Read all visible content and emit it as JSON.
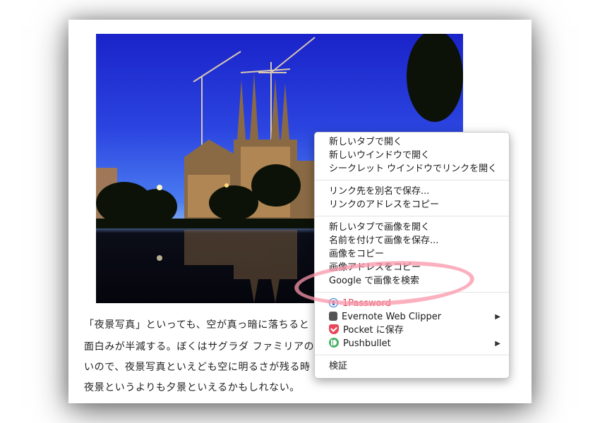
{
  "article": {
    "lines": [
      "「夜景写真」といっても、空が真っ暗に落ちると",
      "面白みが半減する。ぼくはサグラダ ファミリアの",
      "いので、夜景写真といえども空に明るさが残る時",
      "夜景というよりも夕景といえるかもしれない。"
    ]
  },
  "context_menu": {
    "group1": [
      "新しいタブで開く",
      "新しいウインドウで開く",
      "シークレット ウインドウでリンクを開く"
    ],
    "group2": [
      "リンク先を別名で保存...",
      "リンクのアドレスをコピー"
    ],
    "group3": [
      "新しいタブで画像を開く",
      "名前を付けて画像を保存...",
      "画像をコピー",
      "画像アドレスをコピー",
      "Google で画像を検索"
    ],
    "extensions": [
      {
        "label": "1Password",
        "icon": "1password-icon",
        "color": "#1a6fd6"
      },
      {
        "label": "Evernote Web Clipper",
        "icon": "evernote-icon",
        "color": "#555555"
      },
      {
        "label": "Pocket に保存",
        "icon": "pocket-icon",
        "color": "#e8475a"
      },
      {
        "label": "Pushbullet",
        "icon": "pushbullet-icon",
        "color": "#4ab367"
      }
    ],
    "inspect": "検証"
  },
  "colors": {
    "highlight": "#f896aa",
    "sky": "#2b44e0"
  }
}
